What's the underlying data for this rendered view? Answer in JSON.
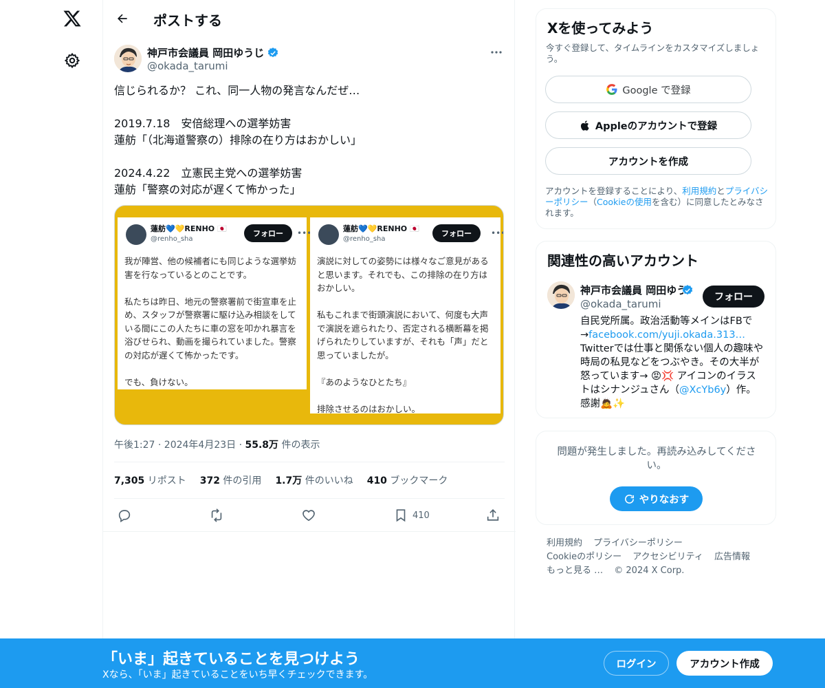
{
  "header": {
    "title": "ポストする"
  },
  "author": {
    "name": "神戸市会議員 岡田ゆうじ",
    "handle": "@okada_tarumi"
  },
  "tweet": {
    "text": "信じられるか？ これ、同一人物の発言なんだぜ…\n\n2019.7.18　安倍総理への選挙妨害\n蓮舫「（北海道警察の）排除の在り方はおかしい」\n\n2024.4.22　立憲民主党への選挙妨害\n蓮舫「警察の対応が遅くて怖かった」",
    "time": "午後1:27 · 2024年4月23日 · ",
    "views_count": "55.8万",
    "views_label": " 件の表示"
  },
  "media": {
    "card1": {
      "name": "蓮舫💙💛RENHO 🇯🇵",
      "handle": "@renho_sha",
      "follow": "フォロー",
      "body": "我が陣営、他の候補者にも同じような選挙妨害を行なっているとのことです。\n\n私たちは昨日、地元の警察署前で街宣車を止め、スタッフが警察署に駆け込み相談をしている間にこの人たちに車の窓を叩かれ暴言を浴びせられ、動画を撮られていました。警察の対応が遅くて怖かったです。\n\nでも、負けない。"
    },
    "card2": {
      "name": "蓮舫💙💛RENHO 🇯🇵",
      "handle": "@renho_sha",
      "follow": "フォロー",
      "body": "演説に対しての姿勢には様々なご意見があると思います。それでも、この排除の在り方はおかしい。\n\n私もこれまで街頭演説において、何度も大声で演説を遮られたり、否定される横断幕を掲げられたりしていますが、それも「声」だと思っていましたが。\n\n『あのようなひとたち』\n\n排除させるのはおかしい。"
    }
  },
  "stats": {
    "reposts_count": "7,305",
    "reposts_label": " リポスト",
    "quotes_count": "372",
    "quotes_label": " 件の引用",
    "likes_count": "1.7万",
    "likes_label": " 件のいいね",
    "bookmarks_count": "410",
    "bookmarks_label": " ブックマーク"
  },
  "actions": {
    "bookmark_count": "410"
  },
  "signup_box": {
    "title": "Xを使ってみよう",
    "subtitle": "今すぐ登録して、タイムラインをカスタマイズしましょう。",
    "google": "Google で登録",
    "apple": "Appleのアカウントで登録",
    "create": "アカウントを作成",
    "legal_1": "アカウントを登録することにより、",
    "legal_terms": "利用規約",
    "legal_2": "と",
    "legal_privacy": "プライバシーポリシー",
    "legal_3": "（",
    "legal_cookie": "Cookieの使用",
    "legal_4": "を含む）に同意したとみなされます。"
  },
  "related": {
    "title": "関連性の高いアカウント",
    "name": "神戸市会議員 岡田ゆうじ",
    "handle": "@okada_tarumi",
    "follow": "フォロー",
    "bio_1": "自民党所属。政治活動等メインはFBで→",
    "bio_link": "facebook.com/yuji.okada.313…",
    "bio_2": " Twitterでは仕事と関係ない個人の趣味や時局の私見などをつぶやき。その大半が怒っています→ 😡💢 アイコンのイラストはシナンジュさん（",
    "bio_mention": "@XcYb6y",
    "bio_3": "）作。感謝🙇✨"
  },
  "error_box": {
    "message": "問題が発生しました。再読み込みしてください。",
    "retry": "やりなおす"
  },
  "footer": {
    "terms": "利用規約",
    "privacy": "プライバシーポリシー",
    "cookie": "Cookieのポリシー",
    "accessibility": "アクセシビリティ",
    "ads": "広告情報",
    "more": "もっと見る …",
    "copyright": "© 2024 X Corp."
  },
  "banner": {
    "title": "「いま」起きていることを見つけよう",
    "subtitle": "Xなら、「いま」起きていることをいち早くチェックできます。",
    "login": "ログイン",
    "signup": "アカウント作成"
  },
  "colors": {
    "accent": "#1d9bf0",
    "media_bg": "#e8b80c",
    "text": "#0f1419",
    "muted": "#536471"
  },
  "icons": [
    "x-logo-icon",
    "gear-icon",
    "back-arrow-icon",
    "verified-icon",
    "more-icon",
    "reply-icon",
    "repost-icon",
    "like-icon",
    "bookmark-icon",
    "share-icon",
    "google-icon",
    "apple-icon",
    "refresh-icon"
  ]
}
